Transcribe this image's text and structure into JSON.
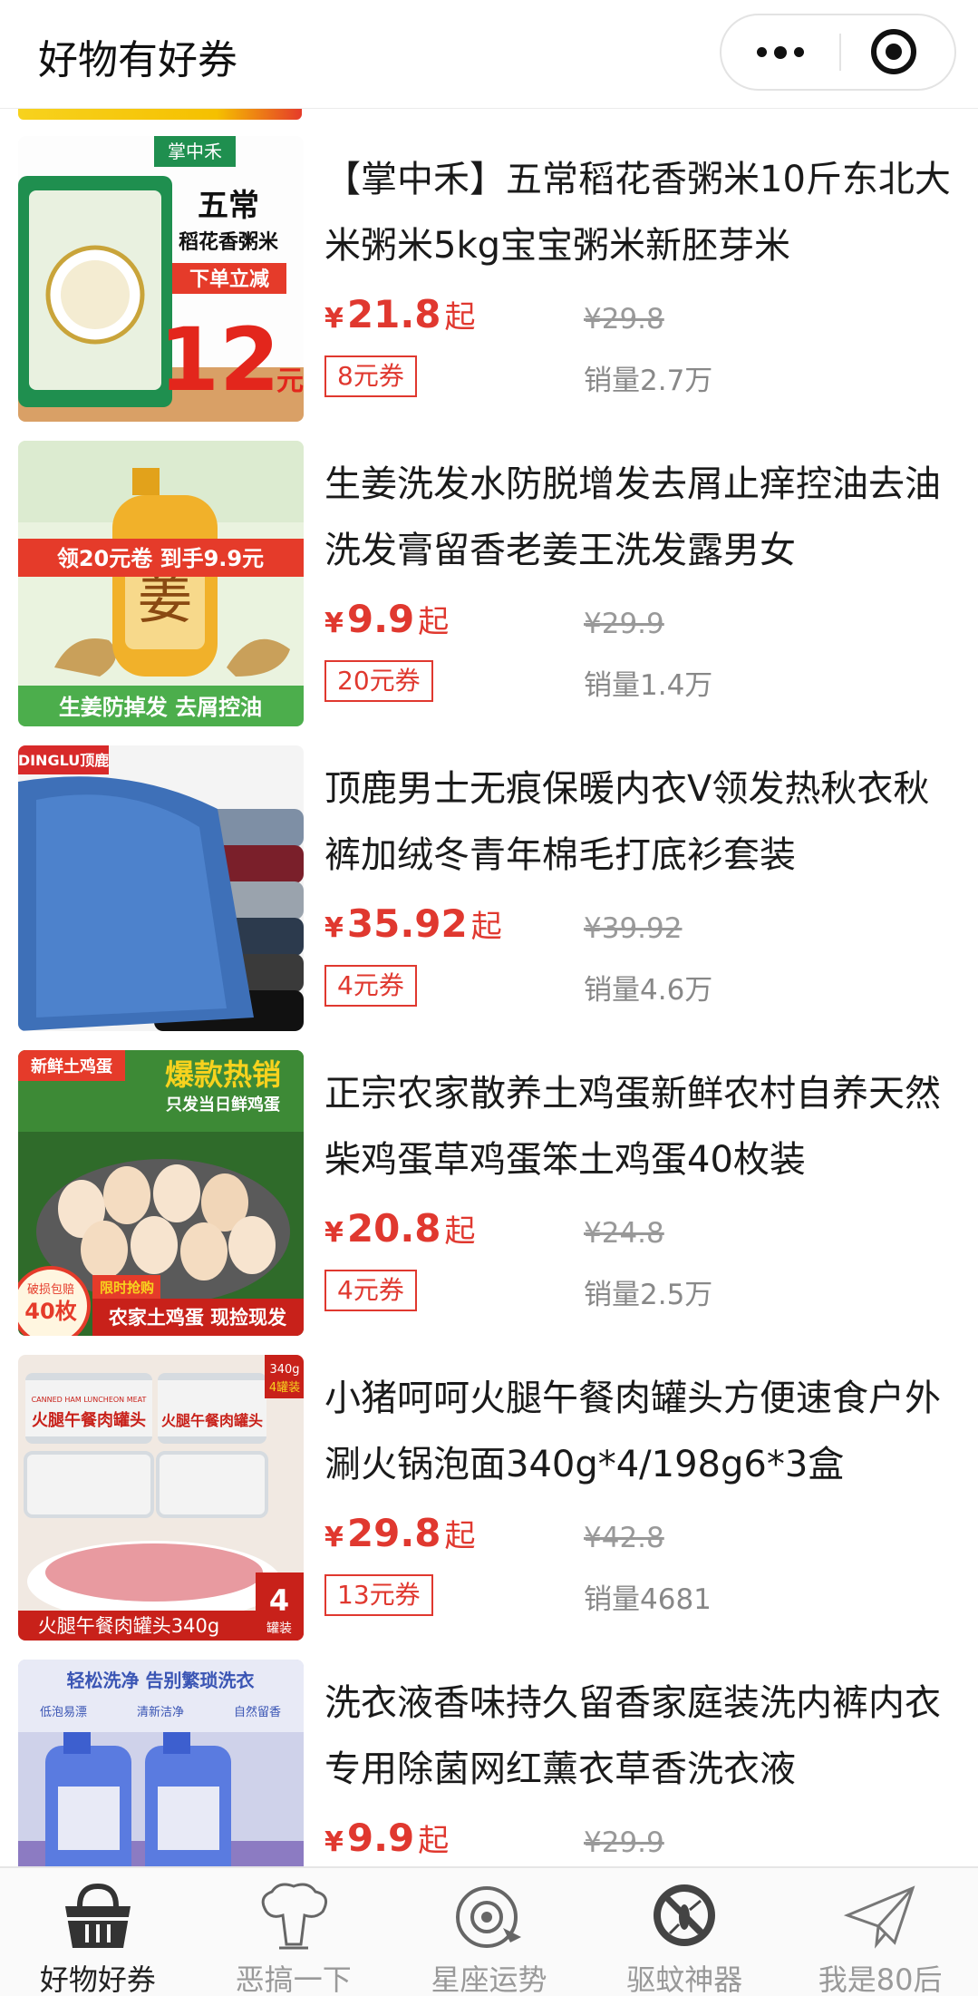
{
  "app": {
    "title": "好物有好券"
  },
  "products": [
    {
      "title": "【掌中禾】五常稻花香粥米10斤东北大米粥米5kg宝宝粥米新胚芽米",
      "price": "21.8",
      "currency": "¥",
      "price_suffix": "起",
      "original_price": "¥29.8",
      "coupon": "8元券",
      "sales": "销量2.7万",
      "image": {
        "brand": "掌中禾",
        "line1": "五常",
        "line2": "稻花香粥米",
        "badge": "下单立减",
        "big": "12",
        "unit": "元"
      }
    },
    {
      "title": "生姜洗发水防脱增发去屑止痒控油去油洗发膏留香老姜王洗发露男女",
      "price": "9.9",
      "currency": "¥",
      "price_suffix": "起",
      "original_price": "¥29.9",
      "coupon": "20元券",
      "sales": "销量1.4万",
      "image": {
        "banner": "领20元卷 到手9.9元",
        "bottle": "姜",
        "footer": "生姜防掉发  去屑控油"
      }
    },
    {
      "title": "顶鹿男士无痕保暖内衣V领发热秋衣秋裤加绒冬青年棉毛打底衫套装",
      "price": "35.92",
      "currency": "¥",
      "price_suffix": "起",
      "original_price": "¥39.92",
      "coupon": "4元券",
      "sales": "销量4.6万",
      "image": {
        "brand": "DINGLU顶鹿"
      }
    },
    {
      "title": "正宗农家散养土鸡蛋新鲜农村自养天然柴鸡蛋草鸡蛋笨土鸡蛋40枚装",
      "price": "20.8",
      "currency": "¥",
      "price_suffix": "起",
      "original_price": "¥24.8",
      "coupon": "4元券",
      "sales": "销量2.5万",
      "image": {
        "tag": "新鲜土鸡蛋",
        "headline": "爆款热销",
        "sub": "只发当日鲜鸡蛋",
        "circle_top": "破损包赔",
        "circle_num": "40枚",
        "limited": "限时抢购",
        "footer": "农家土鸡蛋 现捡现发"
      }
    },
    {
      "title": "小猪呵呵火腿午餐肉罐头方便速食户外涮火锅泡面340g*4/198g6*3盒",
      "price": "29.8",
      "currency": "¥",
      "price_suffix": "起",
      "original_price": "¥42.8",
      "coupon": "13元券",
      "sales": "销量4681",
      "image": {
        "can_label": "火腿午餐肉罐头",
        "can_en": "CANNED HAM LUNCHEON MEAT",
        "badge_top": "340g",
        "badge_bottom": "4罐装",
        "footer": "火腿午餐肉罐头340g",
        "count": "4",
        "count_unit": "罐装"
      }
    },
    {
      "title": "洗衣液香味持久留香家庭装洗内裤内衣专用除菌网红薰衣草香洗衣液",
      "price": "9.9",
      "currency": "¥",
      "price_suffix": "起",
      "original_price": "¥29.9",
      "coupon": "",
      "sales": "",
      "image": {
        "headline": "轻松洗净 告别繁琐洗衣",
        "checks": [
          "低泡易漂",
          "清新洁净",
          "自然留香"
        ]
      }
    }
  ],
  "tabbar": {
    "tabs": [
      {
        "label": "好物好券",
        "icon": "basket-icon",
        "active": true
      },
      {
        "label": "恶搞一下",
        "icon": "mushroom-cloud-icon",
        "active": false
      },
      {
        "label": "星座运势",
        "icon": "horoscope-icon",
        "active": false
      },
      {
        "label": "驱蚊神器",
        "icon": "no-mosquito-icon",
        "active": false
      },
      {
        "label": "我是80后",
        "icon": "paper-plane-icon",
        "active": false
      }
    ]
  },
  "colors": {
    "accent": "#e0382f",
    "muted": "#999999",
    "tab_active": "#222222"
  }
}
